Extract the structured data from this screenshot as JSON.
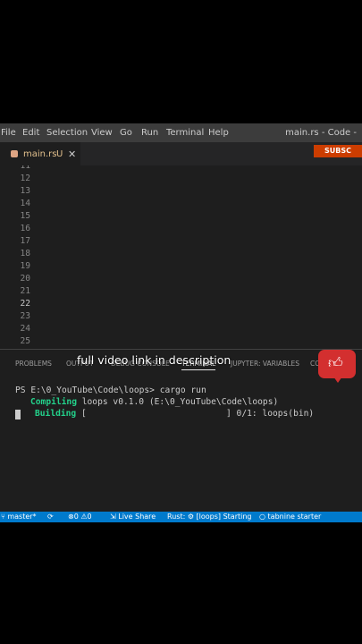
{
  "menu": [
    "File",
    "Edit",
    "Selection",
    "View",
    "Go",
    "Run",
    "Terminal",
    "Help"
  ],
  "window_title": "main.rs - Code -",
  "tab": {
    "name": "main.rs",
    "modified": "U",
    "close": "✕"
  },
  "subscribe_badge": "SUBSC",
  "editor": {
    "line_numbers": [
      "11",
      "12",
      "13",
      "14",
      "15",
      "16",
      "17",
      "18",
      "19",
      "20",
      "21",
      "22",
      "23",
      "24",
      "25"
    ],
    "active_line": "22"
  },
  "panel_tabs": [
    "PROBLEMS",
    "OUTPUT",
    "DEBUG CONSOLE",
    "TERMINAL",
    "JUPYTER: VARIABLES",
    "CO"
  ],
  "overlay_text": "full video link in description",
  "terminal": {
    "prompt": "PS E:\\0_YouTube\\Code\\loops> ",
    "command": "cargo run",
    "compiling_label": "Compiling",
    "compiling_text": " loops v0.1.0 (E:\\0_YouTube\\Code\\loops)",
    "building_label": "Building",
    "building_bar": " [",
    "building_progress": "] 0/1: loops(bin)"
  },
  "status": {
    "branch": "master*",
    "errors": "0",
    "warnings": "0",
    "live_share": "Live Share",
    "rust": "Rust:",
    "rust_status": "[loops] Starting",
    "tabnine": "tabnine starter"
  }
}
